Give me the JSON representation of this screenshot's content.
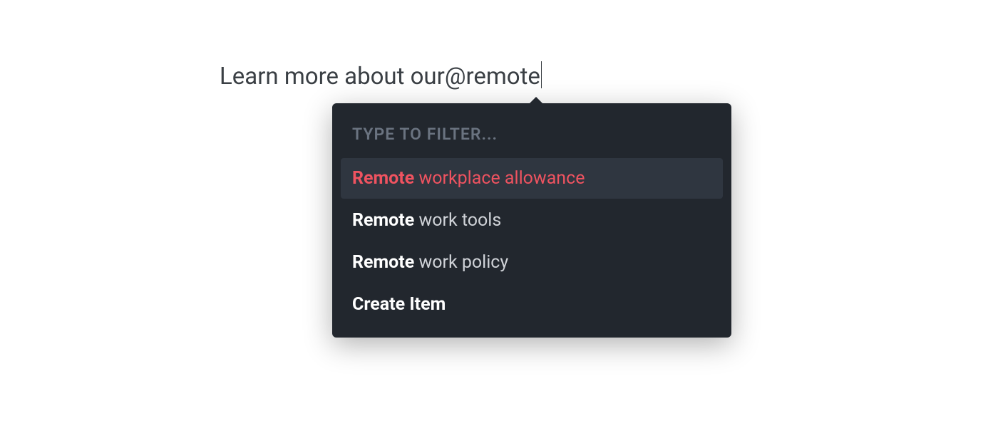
{
  "input": {
    "prefix_text": "Learn more about our ",
    "mention_text": "@remote"
  },
  "dropdown": {
    "filter_label": "Type to filter...",
    "items": [
      {
        "match": "Remote",
        "rest": " workplace allowance",
        "selected": true
      },
      {
        "match": "Remote",
        "rest": " work tools",
        "selected": false
      },
      {
        "match": "Remote",
        "rest": " work policy",
        "selected": false
      }
    ],
    "create_label": "Create Item"
  }
}
